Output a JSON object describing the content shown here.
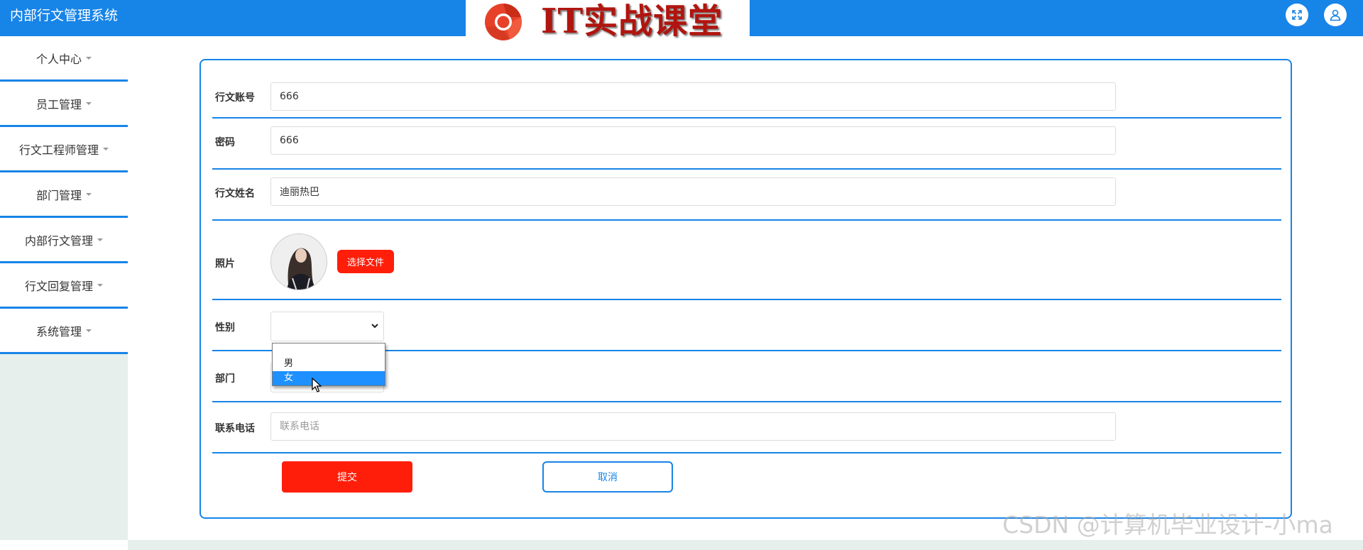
{
  "header": {
    "app_title": "内部行文管理系统",
    "banner_text": "IT实战课堂",
    "fullscreen_icon": "fullscreen-icon",
    "user_icon": "user-icon",
    "accent_color": "#1784e8"
  },
  "sidebar": {
    "items": [
      {
        "label": "个人中心"
      },
      {
        "label": "员工管理"
      },
      {
        "label": "行文工程师管理"
      },
      {
        "label": "部门管理"
      },
      {
        "label": "内部行文管理"
      },
      {
        "label": "行文回复管理"
      },
      {
        "label": "系统管理"
      }
    ]
  },
  "form": {
    "account": {
      "label": "行文账号",
      "value": "666"
    },
    "password": {
      "label": "密码",
      "value": "666"
    },
    "name": {
      "label": "行文姓名",
      "value": "迪丽热巴"
    },
    "photo": {
      "label": "照片",
      "choose_file_label": "选择文件"
    },
    "gender": {
      "label": "性别",
      "value": "",
      "options": [
        {
          "label": ""
        },
        {
          "label": "男"
        },
        {
          "label": "女",
          "highlighted": true
        }
      ]
    },
    "department": {
      "label": "部门",
      "value": ""
    },
    "phone": {
      "label": "联系电话",
      "value": "",
      "placeholder": "联系电话"
    },
    "submit_label": "提交",
    "cancel_label": "取消",
    "submit_color": "#ff1e0a"
  },
  "watermark": "CSDN @计算机毕业设计-小ma"
}
